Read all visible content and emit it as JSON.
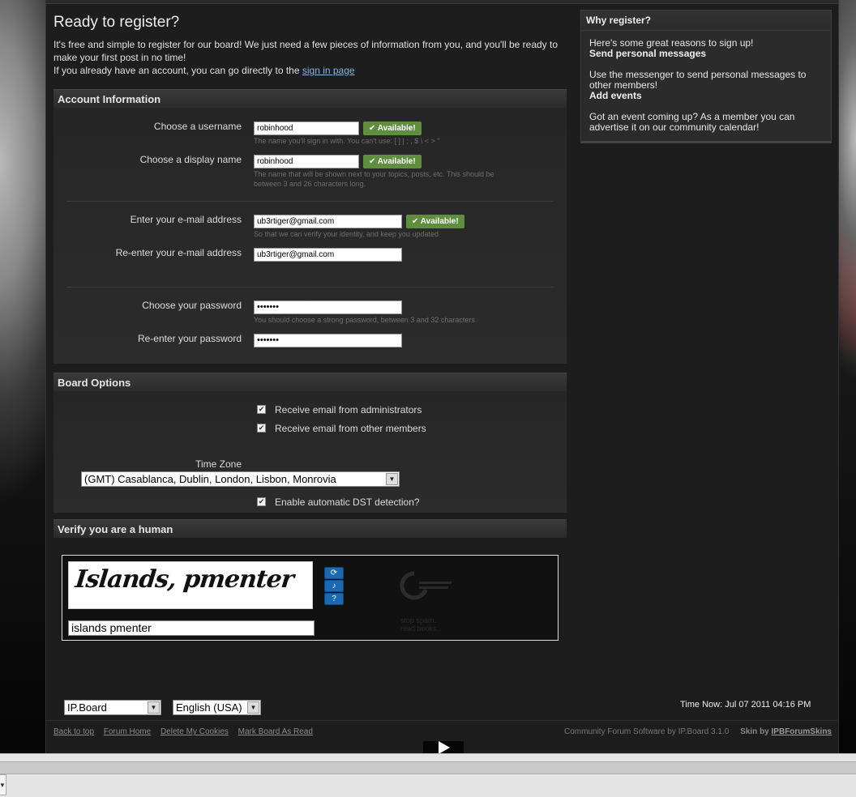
{
  "page": {
    "title": "Ready to register?",
    "intro_line1": "It's free and simple to register for our board! We just need a few pieces of information from you, and you'll be ready to make your first post in no time!",
    "intro_line2_prefix": "If you already have an account, you can go directly to the ",
    "intro_link": "sign in page"
  },
  "account": {
    "heading": "Account Information",
    "username_label": "Choose a username",
    "username_value": "robinhood",
    "username_status": "✔ Available!",
    "username_hint": "The name you'll sign in with. You can't use: [ ] | ; , $ \\ < > \"",
    "display_label": "Choose a display name",
    "display_value": "robinhood",
    "display_status": "✔ Available!",
    "display_hint1": "The name that will be shown next to your topics, posts, etc. This should be",
    "display_hint2": "between 3 and 26 characters long.",
    "email_label": "Enter your e-mail address",
    "email_value": "ub3rtiger@gmail.com",
    "email_status": "✔ Available!",
    "email_hint": "So that we can verify your identity, and keep you updated",
    "email2_label": "Re-enter your e-mail address",
    "email2_value": "ub3rtiger@gmail.com",
    "password_label": "Choose your password",
    "password_value": "•••••••",
    "password_hint": "You should choose a strong password, between 3 and 32 characters",
    "password2_label": "Re-enter your password",
    "password2_value": "•••••••"
  },
  "board": {
    "heading": "Board Options",
    "opt_admin": "Receive email from administrators",
    "opt_members": "Receive email from other members",
    "timezone_label": "Time Zone",
    "timezone_value": "(GMT) Casablanca, Dublin, London, Lisbon, Monrovia",
    "opt_dst": "Enable automatic DST detection?"
  },
  "verify": {
    "heading": "Verify you are a human",
    "captcha_word": "Islands, pmenter",
    "captcha_answer": "islands pmenter",
    "recaptcha_line1": "stop spam.",
    "recaptcha_line2": "read books."
  },
  "sidebar": {
    "heading": "Why register?",
    "intro": "Here's some great reasons to sign up!",
    "item1_title": "Send personal messages",
    "item1_text": "Use the messenger to send personal messages to other members!",
    "item2_title": "Add events",
    "item2_text": "Got an event coming up? As a member you can advertise it on our community calendar!"
  },
  "footer": {
    "skin_select": "IP.Board",
    "lang_select": "English (USA)",
    "time_now": "Time Now: Jul 07 2011 04:16 PM",
    "links": [
      "Back to top",
      "Forum Home",
      "Delete My Cookies",
      "Mark Board As Read"
    ],
    "powered": "Community Forum Software by IP.Board 3.1.0",
    "skin_by_prefix": "Skin by ",
    "skin_by_link": "IPBForumSkins"
  },
  "colors": {
    "available_badge": "#5f8f3e",
    "link": "#8fb3d9",
    "panel_bg": "#1d1d1d"
  }
}
